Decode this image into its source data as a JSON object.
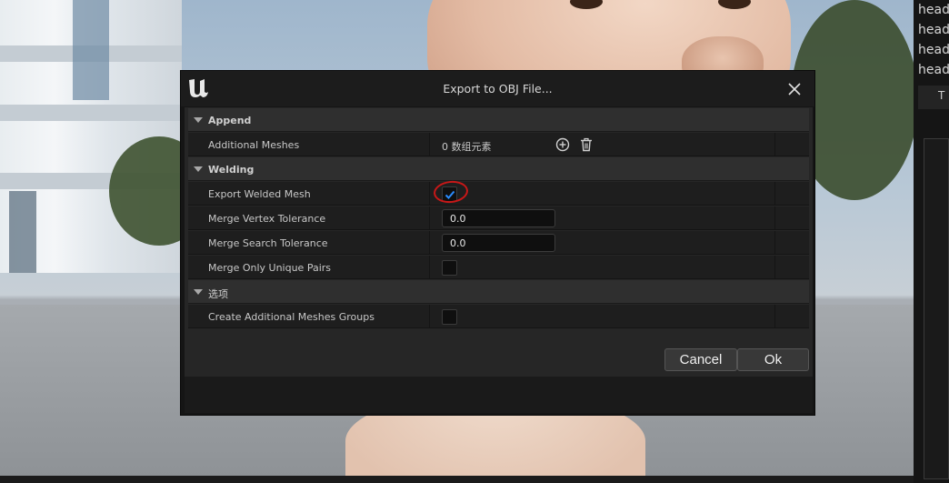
{
  "side_panel": {
    "lines": [
      "head",
      "head",
      "head",
      "head"
    ],
    "tab_label": "T"
  },
  "dialog": {
    "title": "Export to OBJ File...",
    "categories": [
      {
        "label": "Append",
        "properties": [
          {
            "name": "Additional Meshes",
            "value": "0 数组元素"
          }
        ]
      },
      {
        "label": "Welding",
        "properties": [
          {
            "name": "Export Welded Mesh",
            "checked": true
          },
          {
            "name": "Merge Vertex Tolerance",
            "value": "0.0"
          },
          {
            "name": "Merge Search Tolerance",
            "value": "0.0"
          },
          {
            "name": "Merge Only Unique Pairs",
            "checked": false
          }
        ]
      },
      {
        "label": "选项",
        "properties": [
          {
            "name": "Create Additional Meshes Groups",
            "checked": false
          }
        ]
      }
    ],
    "cancel_label": "Cancel",
    "ok_label": "Ok"
  },
  "colors": {
    "checkbox_check": "#2a8cff",
    "annotation_circle": "#c81818",
    "dialog_bg": "#262626"
  }
}
